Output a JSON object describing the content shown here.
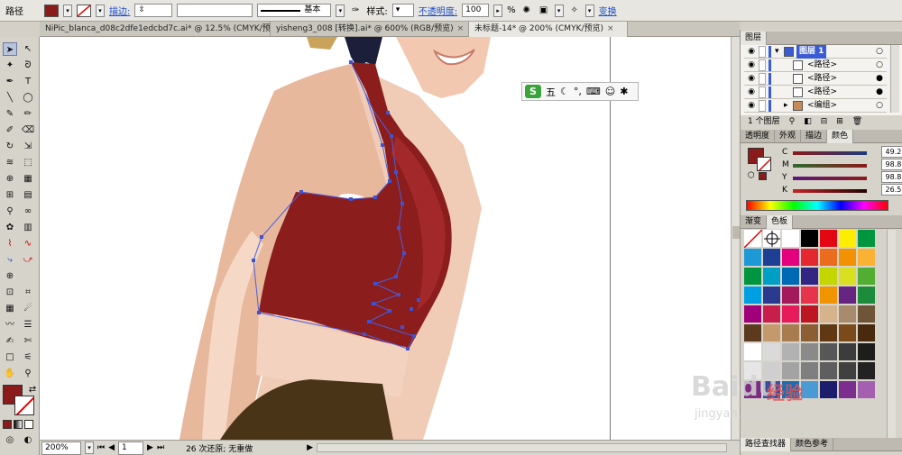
{
  "control_bar": {
    "object_type": "路径",
    "fill_color": "#8b1a1a",
    "stroke_label": "描边:",
    "stroke_style": "基本",
    "style_label": "样式:",
    "opacity_label": "不透明度:",
    "opacity_value": "100",
    "opacity_unit": "%",
    "transform_label": "变换"
  },
  "tabs": [
    {
      "label": "NiPic_blanca_d08c2dfe1edcbd7c.ai* @ 12.5% (CMYK/预览)",
      "active": false
    },
    {
      "label": "yisheng3_008 [转换].ai* @ 600% (RGB/预览)",
      "active": false
    },
    {
      "label": "未标题-14* @ 200% (CMYK/预览)",
      "active": true
    }
  ],
  "status_bar": {
    "zoom": "200%",
    "page": "1",
    "message": "26 次还原; 无重做"
  },
  "ime_bar": {
    "mode": "五"
  },
  "layers_panel": {
    "title": "图层",
    "rows": [
      {
        "name": "图层 1",
        "level": 0
      },
      {
        "name": "<路径>",
        "level": 1
      },
      {
        "name": "<路径>",
        "level": 1
      },
      {
        "name": "<路径>",
        "level": 1
      },
      {
        "name": "<编组>",
        "level": 1
      }
    ],
    "footer": "1 个图层"
  },
  "appearance_tabs": [
    "透明度",
    "外观",
    "描边",
    "颜色"
  ],
  "color_panel": {
    "channels": [
      {
        "name": "C",
        "value": "49.22"
      },
      {
        "name": "M",
        "value": "98.83"
      },
      {
        "name": "Y",
        "value": "98.83"
      },
      {
        "name": "K",
        "value": "26.56"
      }
    ],
    "unit": "%",
    "fill": "#8b1a1a"
  },
  "swatch_tabs": [
    "渐变",
    "色板"
  ],
  "swatches": [
    "#ffffff",
    "#ffffff",
    "#ffffff",
    "#000000",
    "#e30613",
    "#ffed00",
    "#00963f",
    "#1d9ad6",
    "#1d3f94",
    "#e5007d",
    "#e5282f",
    "#ec6c1d",
    "#f39200",
    "#f9b233",
    "#009640",
    "#00a0c6",
    "#0069b4",
    "#312783",
    "#c4d600",
    "#d9e021",
    "#52ae32",
    "#009fe3",
    "#2a3a8f",
    "#a3195b",
    "#e7344c",
    "#f29400",
    "#662483",
    "#1c8c3c",
    "#a2007a",
    "#c81e4b",
    "#e71a5c",
    "#bd1622",
    "#d5b48c",
    "#a88b6c",
    "#6f5537",
    "#5b3a1e",
    "#c49a6c",
    "#a97c50",
    "#8b5e34",
    "#603913",
    "#7a4a1a",
    "#4a2a0e",
    "#ffffff",
    "#dadada",
    "#b2b2b2",
    "#8a8a8a",
    "#575757",
    "#3c3c3c",
    "#1d1d1b",
    "#e6e6e6",
    "#cfcfcf",
    "#a3a3a3",
    "#7f7f7f",
    "#5e5e5e",
    "#404040",
    "#222222",
    "#7d2a82",
    "#3b4ea1",
    "#1b6db3",
    "#4a9bd4",
    "#1d1d6e",
    "#7b2e8b",
    "#a45fb0"
  ],
  "bottom_tabs": [
    "路径查找器",
    "颜色参考"
  ],
  "watermark": {
    "brand": "Baidu",
    "suffix": "经验",
    "url": "jingyan.baidu.com"
  }
}
